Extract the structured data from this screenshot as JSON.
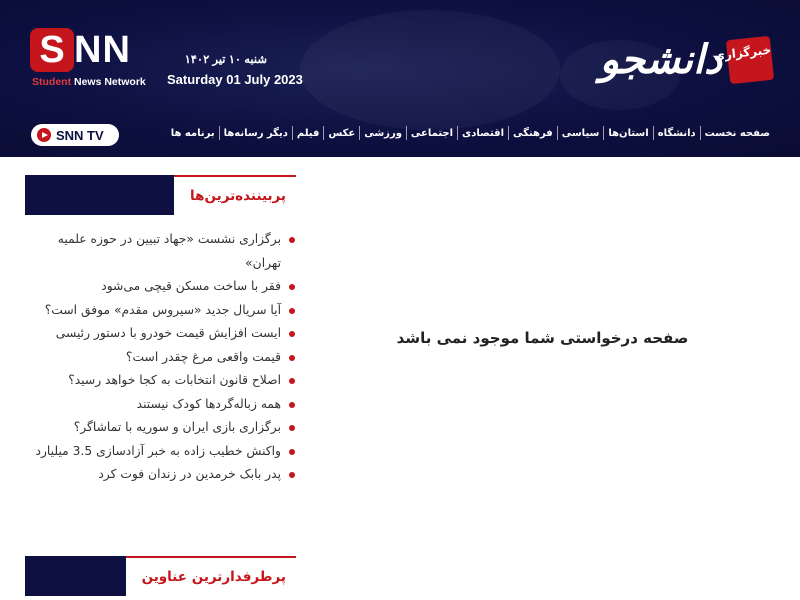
{
  "header": {
    "snn_logo": {
      "brand_red": "SNN",
      "tagline_red": "Student",
      "tagline_white": " News Network"
    },
    "date_fa": "شنبه ۱۰ تیر ۱۴۰۲",
    "date_en": "Saturday 01 July 2023",
    "site_logo": {
      "badge": "خبرگزاری",
      "name": "دانشجو"
    },
    "snntv": {
      "label": "SNN TV"
    },
    "nav": [
      "صفحه نخست",
      "دانشگاه",
      "استان‌ها",
      "سیاسی",
      "فرهنگی",
      "اقتصادی",
      "اجتماعی",
      "ورزشی",
      "عکس",
      "فیلم",
      "دیگر رسانه‌ها",
      "برنامه ها"
    ]
  },
  "sidebar": {
    "most_viewed": {
      "title": "پربیننده‌ترین‌ها",
      "items": [
        "برگزاری نشست «جهاد تبیین در حوزه علمیه تهران»",
        "فقر با ساخت مسکن قیچی می‌شود",
        "آیا سریال جدید «سیروس مقدم» موفق است؟",
        "ایست افزایش قیمت خودرو با دستور رئیسی",
        "قیمت واقعی مرغ چقدر است؟",
        "اصلاح قانون انتخابات به کجا خواهد رسید؟",
        "همه زباله‌گردها کودک نیستند",
        "برگزاری بازی ایران و سوریه با تماشاگر؟",
        "واکنش خطیب زاده به خبر آزادسازی 3.5 میلیارد",
        "پدر بابک خرمدین در زندان فوت کرد"
      ]
    },
    "most_discussed": {
      "title": "پرطرفدارترین عناوین"
    }
  },
  "main": {
    "message": "صفحه درخواستی شما موجود نمی باشد"
  },
  "colors": {
    "navy": "#0d1040",
    "red": "#c4161c"
  }
}
